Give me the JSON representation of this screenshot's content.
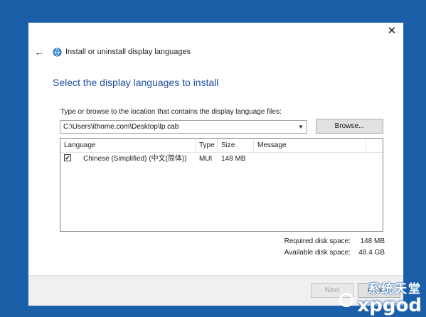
{
  "window": {
    "close_glyph": "✕",
    "back_glyph": "←",
    "title": "Install or uninstall display languages"
  },
  "main": {
    "heading": "Select the display languages to install",
    "path_label": "Type or browse to the location that contains the display language files:",
    "path_value": "C:\\Users\\ithome.com\\Desktop\\lp.cab",
    "browse_label": "Browse..."
  },
  "list": {
    "columns": [
      "Language",
      "Type",
      "Size",
      "Message"
    ],
    "rows": [
      {
        "checked": "✔",
        "language": "Chinese (Simplified) (中文(简体))",
        "type": "MUI",
        "size": "148 MB",
        "message": ""
      }
    ]
  },
  "disk": {
    "required_label": "Required disk space:",
    "required_value": "148 MB",
    "available_label": "Available disk space:",
    "available_value": "48.4 GB"
  },
  "footer": {
    "next_label": "Next",
    "cancel_label": "Cancel"
  },
  "watermark": {
    "top": "系统天堂",
    "bottom": "xpgod"
  },
  "colors": {
    "desktop": "#1a5fa8",
    "heading": "#1f4e9c"
  },
  "icons": [
    "close-icon",
    "back-arrow-icon",
    "globe-icon",
    "chevron-down-icon",
    "checkbox-icon"
  ]
}
